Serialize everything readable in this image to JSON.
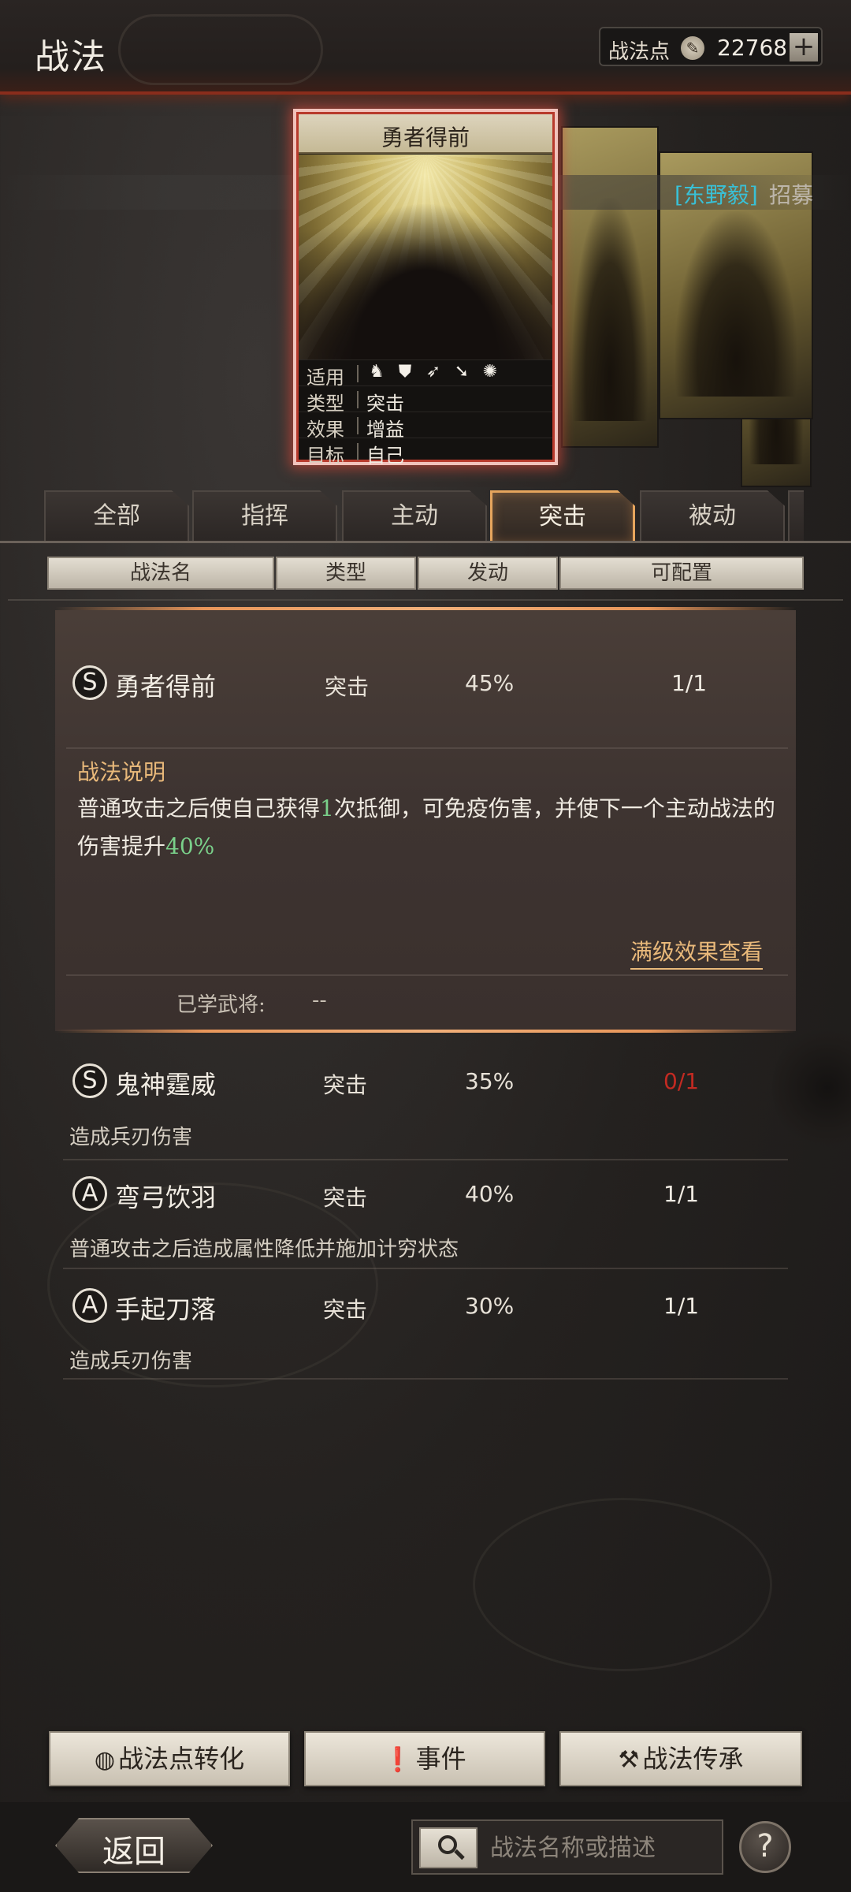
{
  "header": {
    "title": "战法",
    "points_label": "战法点",
    "points_icon": "compass-icon",
    "points_value": "22768",
    "add_label": "+"
  },
  "card": {
    "title": "勇者得前",
    "hero_name": "[东野毅]",
    "hero_suffix": "招募",
    "labels": {
      "applicable": "适用",
      "type": "类型",
      "effect": "效果",
      "target": "目标"
    },
    "type_value": "突击",
    "effect_value": "增益",
    "target_value": "自己",
    "troop_icons": [
      "cavalry-icon",
      "shield-icon",
      "bow-icon",
      "spear-icon",
      "wheel-icon"
    ]
  },
  "tabs": [
    "全部",
    "指挥",
    "主动",
    "突击",
    "被动"
  ],
  "active_tab": "突击",
  "columns": {
    "name": "战法名",
    "type": "类型",
    "rate": "发动",
    "config": "可配置"
  },
  "selected": {
    "grade": "S",
    "name": "勇者得前",
    "type": "突击",
    "rate": "45%",
    "config": "1/1",
    "desc_title": "战法说明",
    "desc_part1": "普通攻击之后使自己获得",
    "desc_num1": "1",
    "desc_part2": "次抵御，可免疫伤害，并使下一个主动战法的伤害提升",
    "desc_num2": "40%",
    "full_link": "满级效果查看",
    "learned_label": "已学武将:",
    "learned_value": "--"
  },
  "list": [
    {
      "grade": "S",
      "name": "鬼神霆威",
      "type": "突击",
      "rate": "35%",
      "config": "0/1",
      "desc": "造成兵刃伤害"
    },
    {
      "grade": "A",
      "name": "弯弓饮羽",
      "type": "突击",
      "rate": "40%",
      "config": "1/1",
      "desc": "普通攻击之后造成属性降低并施加计穷状态"
    },
    {
      "grade": "A",
      "name": "手起刀落",
      "type": "突击",
      "rate": "30%",
      "config": "1/1",
      "desc": "造成兵刃伤害"
    }
  ],
  "buttons": {
    "convert": "战法点转化",
    "event": "事件",
    "inherit": "战法传承",
    "back": "返回",
    "help": "?"
  },
  "search": {
    "placeholder": "战法名称或描述"
  },
  "colors": {
    "accent_orange": "#e9b97a",
    "highlight_green": "#7ad08a",
    "hero_cyan": "#39c0d6",
    "alert_red": "#c22a22"
  }
}
